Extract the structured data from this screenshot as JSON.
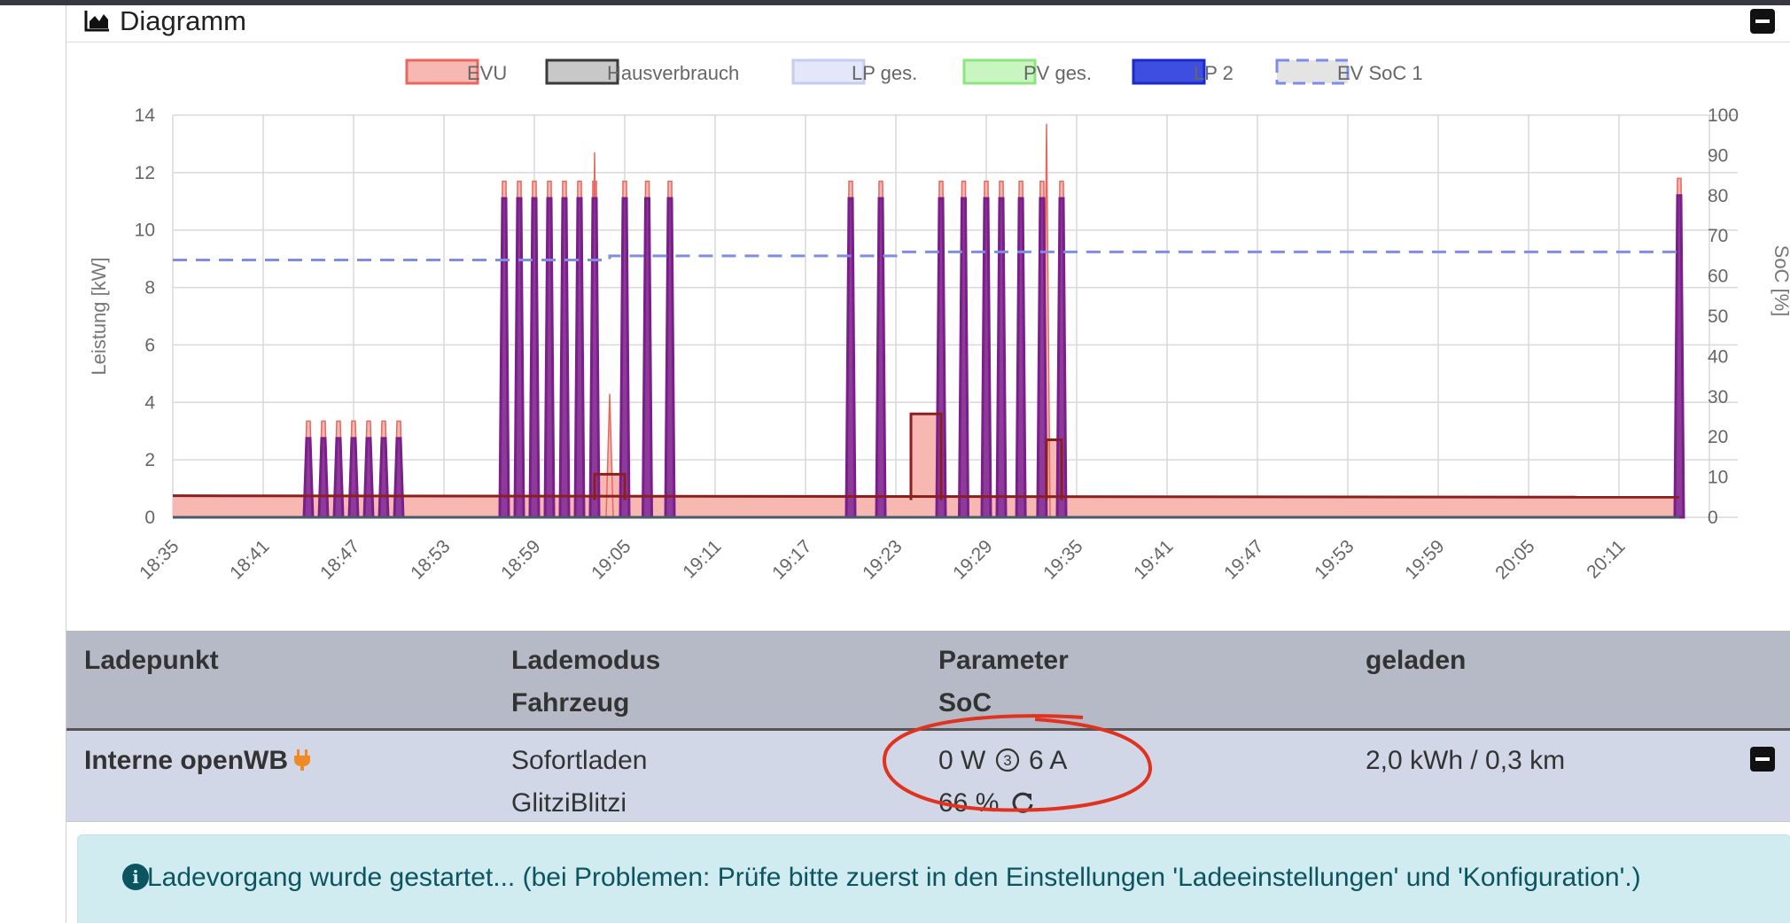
{
  "card": {
    "title": "Diagramm",
    "icon": "area-chart-icon"
  },
  "chart_data": {
    "type": "area",
    "ylabel_left": "Leistung [kW]",
    "ylabel_right": "SoC [%]",
    "ylim_left": [
      0,
      14
    ],
    "ylim_right": [
      0,
      100
    ],
    "yticks_left": [
      "0",
      "2",
      "4",
      "6",
      "8",
      "10",
      "12",
      "14"
    ],
    "yticks_right": [
      "0",
      "10",
      "20",
      "30",
      "40",
      "50",
      "60",
      "70",
      "80",
      "90",
      "100"
    ],
    "xticks": [
      "18:35",
      "18:41",
      "18:47",
      "18:53",
      "18:59",
      "19:05",
      "19:11",
      "19:17",
      "19:23",
      "19:29",
      "19:35",
      "19:41",
      "19:47",
      "19:53",
      "19:59",
      "20:05",
      "20:11"
    ],
    "grid": true,
    "legend_position": "top",
    "legend": [
      {
        "name": "EVU",
        "fill": "#f7b8b2",
        "stroke": "#e8675e",
        "dashed": false
      },
      {
        "name": "Hausverbrauch",
        "fill": "#c8c8c8",
        "stroke": "#3a3a3a",
        "dashed": false
      },
      {
        "name": "LP ges.",
        "fill": "#e4e7fa",
        "stroke": "#c5ccf0",
        "dashed": false
      },
      {
        "name": "PV ges.",
        "fill": "#c8f5c0",
        "stroke": "#8ee480",
        "dashed": false
      },
      {
        "name": "LP 2",
        "fill": "#3e4fe0",
        "stroke": "#1a2ad0",
        "dashed": false
      },
      {
        "name": "EV SoC 1",
        "fill": "#e4e4e4",
        "stroke": "#7f8ce8",
        "dashed": true
      }
    ],
    "series": [
      {
        "name": "LP 2",
        "pulses": [
          {
            "start": "18:44",
            "end": "18:50",
            "count": 7,
            "value": 2.75
          },
          {
            "start": "18:57",
            "end": "19:03",
            "count": 7,
            "value": 11.1
          },
          {
            "start": "19:05",
            "end": "19:08",
            "count": 3,
            "value": 11.1
          },
          {
            "start": "19:20",
            "end": "19:22",
            "count": 2,
            "value": 11.1
          },
          {
            "start": "19:26",
            "end": "19:29",
            "count": 3,
            "value": 11.1
          },
          {
            "start": "19:30",
            "end": "19:34",
            "count": 4,
            "value": 11.1
          },
          {
            "start": "20:15",
            "end": "20:15",
            "count": 1,
            "value": 11.2
          }
        ]
      },
      {
        "name": "EVU",
        "offset_above_lp": 0.6,
        "extra_peaks": [
          {
            "x": "19:03",
            "value": 12.7
          },
          {
            "x": "19:04",
            "value": 4.3
          },
          {
            "x": "19:33",
            "value": 13.7
          },
          {
            "x": "19:29",
            "value": 3.4
          }
        ]
      },
      {
        "name": "Hausverbrauch",
        "baseline": 0.6,
        "bumps": [
          {
            "start": "19:03",
            "end": "19:05",
            "value": 1.5
          },
          {
            "start": "19:24",
            "end": "19:26",
            "value": 3.6
          },
          {
            "start": "19:33",
            "end": "19:34",
            "value": 2.7
          }
        ]
      },
      {
        "name": "PV ges.",
        "value": 0
      },
      {
        "name": "LP ges.",
        "value": 0
      },
      {
        "name": "EV SoC 1",
        "axis": "right",
        "points": [
          {
            "x": "18:35",
            "y": 64
          },
          {
            "x": "19:04",
            "y": 64
          },
          {
            "x": "19:04",
            "y": 65
          },
          {
            "x": "19:23",
            "y": 65
          },
          {
            "x": "19:23",
            "y": 66
          },
          {
            "x": "20:15",
            "y": 66
          }
        ]
      }
    ]
  },
  "table": {
    "headers": {
      "ladepunkt": "Ladepunkt",
      "lademodus": "Lademodus",
      "fahrzeug": "Fahrzeug",
      "parameter": "Parameter",
      "soc": "SoC",
      "geladen": "geladen"
    },
    "rows": [
      {
        "ladepunkt": "Interne openWB",
        "plug_icon": "plug-icon",
        "lademodus": "Sofortladen",
        "fahrzeug": "GlitziBlitzi",
        "power": "0 W",
        "phases": "3",
        "current": "6 A",
        "soc": "66 %",
        "refresh_icon": "refresh-icon",
        "geladen": "2,0 kWh / 0,3 km"
      }
    ]
  },
  "alert": {
    "icon": "info-icon",
    "text": "Ladevorgang wurde gestartet... (bei Problemen: Prüfe bitte zuerst in den Einstellungen 'Ladeeinstellungen' und 'Konfiguration'.)"
  },
  "colors": {
    "evu_fill": "#f7b8b2",
    "evu_line": "#e8675e",
    "house_line": "#8b1f1f",
    "lp_fill": "#8e3a9a",
    "lp_line": "#7a1f8a",
    "lp2_edge": "#3e4fe0",
    "soc_line": "#7f8ce8",
    "table_head_bg": "#b5bac6",
    "row_bg": "#d1d7e6",
    "alert_bg": "#d1ecf1",
    "annotation_red": "#e0321f"
  }
}
